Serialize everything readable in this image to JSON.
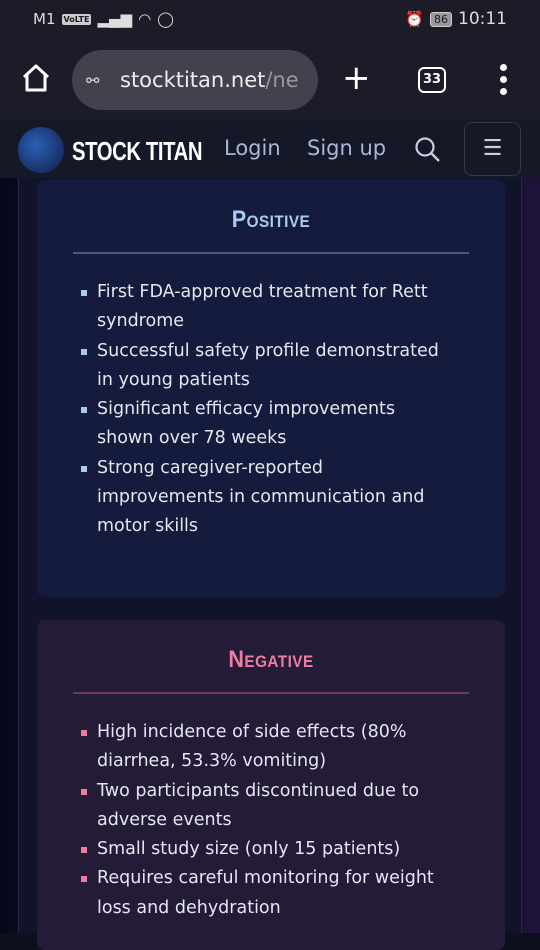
{
  "status_bar": {
    "carrier": "M1",
    "volte": "VoLTE",
    "battery": "86",
    "time": "10:11"
  },
  "browser": {
    "url_host": "stocktitan.net",
    "url_path": "/ne",
    "tab_count": "33"
  },
  "site_header": {
    "brand": "STOCK TITAN",
    "login": "Login",
    "signup": "Sign up"
  },
  "positive": {
    "title": "Positive",
    "items": [
      "First FDA-approved treatment for Rett syndrome",
      "Successful safety profile demonstrated in young patients",
      "Significant efficacy improvements shown over 78 weeks",
      "Strong caregiver-reported improvements in communication and motor skills"
    ]
  },
  "negative": {
    "title": "Negative",
    "items": [
      "High incidence of side effects (80% diarrhea, 53.3% vomiting)",
      "Two participants discontinued due to adverse events",
      "Small study size (only 15 patients)",
      "Requires careful monitoring for weight loss and dehydration"
    ]
  },
  "colors": {
    "positive_accent": "#a9cbf0",
    "negative_accent": "#ef7da3"
  }
}
